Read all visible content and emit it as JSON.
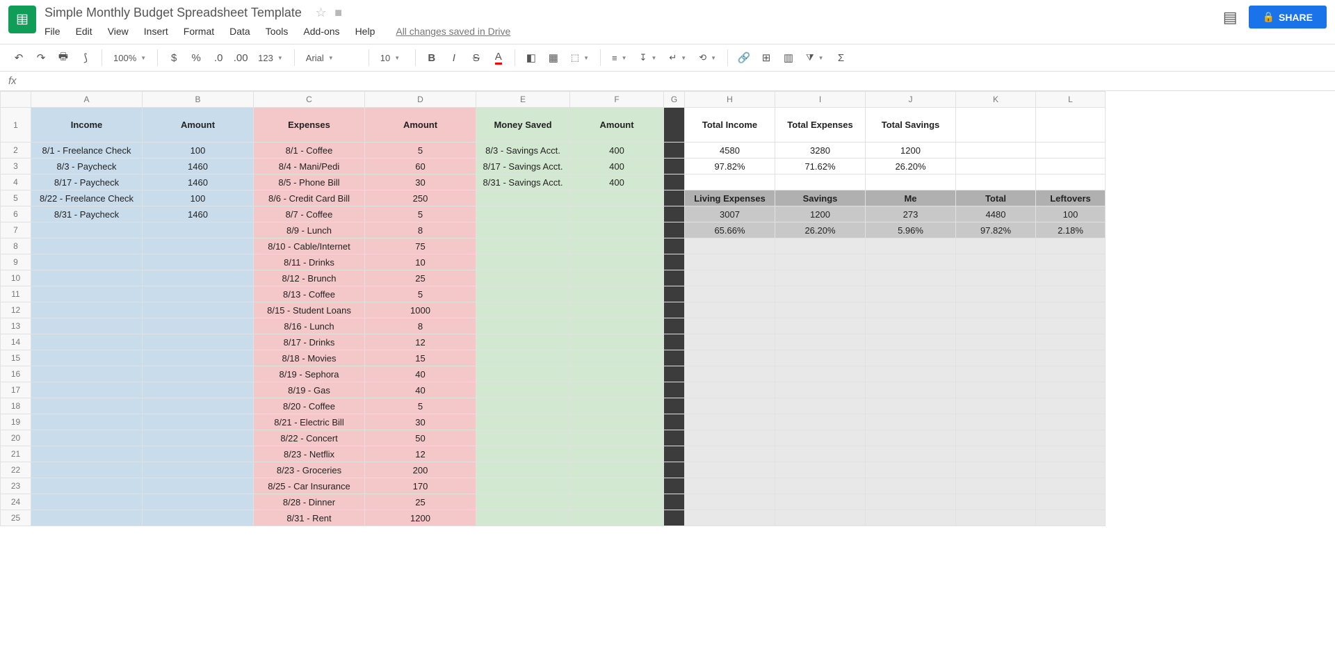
{
  "doc": {
    "title": "Simple Monthly Budget Spreadsheet Template",
    "save_msg": "All changes saved in Drive"
  },
  "menu": [
    "File",
    "Edit",
    "View",
    "Insert",
    "Format",
    "Data",
    "Tools",
    "Add-ons",
    "Help"
  ],
  "share": "SHARE",
  "tb": {
    "zoom": "100%",
    "font": "Arial",
    "size": "10",
    "fmt": "123"
  },
  "cols": [
    "A",
    "B",
    "C",
    "D",
    "E",
    "F",
    "G",
    "H",
    "I",
    "J",
    "K",
    "L"
  ],
  "row1": {
    "A": "Income",
    "B": "Amount",
    "C": "Expenses",
    "D": "Amount",
    "E": "Money Saved",
    "F": "Amount",
    "H": "Total Income",
    "I": "Total Expenses",
    "J": "Total Savings"
  },
  "rows": [
    {
      "A": "8/1 - Freelance Check",
      "B": "100",
      "C": "8/1 - Coffee",
      "D": "5",
      "E": "8/3 - Savings Acct.",
      "F": "400",
      "H": "4580",
      "I": "3280",
      "J": "1200"
    },
    {
      "A": "8/3 - Paycheck",
      "B": "1460",
      "C": "8/4 - Mani/Pedi",
      "D": "60",
      "E": "8/17 - Savings Acct.",
      "F": "400",
      "H": "97.82%",
      "I": "71.62%",
      "J": "26.20%"
    },
    {
      "A": "8/17 - Paycheck",
      "B": "1460",
      "C": "8/5 - Phone Bill",
      "D": "30",
      "E": "8/31 - Savings Acct.",
      "F": "400"
    },
    {
      "A": "8/22 - Freelance Check",
      "B": "100",
      "C": "8/6 - Credit Card Bill",
      "D": "250",
      "H": "Living Expenses",
      "I": "Savings",
      "J": "Me",
      "K": "Total",
      "L": "Leftovers"
    },
    {
      "A": "8/31 - Paycheck",
      "B": "1460",
      "C": "8/7 - Coffee",
      "D": "5",
      "H": "3007",
      "I": "1200",
      "J": "273",
      "K": "4480",
      "L": "100"
    },
    {
      "C": "8/9 - Lunch",
      "D": "8",
      "H": "65.66%",
      "I": "26.20%",
      "J": "5.96%",
      "K": "97.82%",
      "L": "2.18%"
    },
    {
      "C": "8/10 - Cable/Internet",
      "D": "75"
    },
    {
      "C": "8/11 - Drinks",
      "D": "10"
    },
    {
      "C": "8/12 - Brunch",
      "D": "25"
    },
    {
      "C": "8/13 - Coffee",
      "D": "5"
    },
    {
      "C": "8/15 - Student Loans",
      "D": "1000"
    },
    {
      "C": "8/16 - Lunch",
      "D": "8"
    },
    {
      "C": "8/17 - Drinks",
      "D": "12"
    },
    {
      "C": "8/18 - Movies",
      "D": "15"
    },
    {
      "C": "8/19 - Sephora",
      "D": "40"
    },
    {
      "C": "8/19 - Gas",
      "D": "40"
    },
    {
      "C": "8/20 - Coffee",
      "D": "5"
    },
    {
      "C": "8/21 - Electric Bill",
      "D": "30"
    },
    {
      "C": "8/22 - Concert",
      "D": "50"
    },
    {
      "C": "8/23 - Netflix",
      "D": "12"
    },
    {
      "C": "8/23 - Groceries",
      "D": "200"
    },
    {
      "C": "8/25 - Car Insurance",
      "D": "170"
    },
    {
      "C": "8/28 - Dinner",
      "D": "25"
    },
    {
      "C": "8/31 - Rent",
      "D": "1200"
    }
  ]
}
